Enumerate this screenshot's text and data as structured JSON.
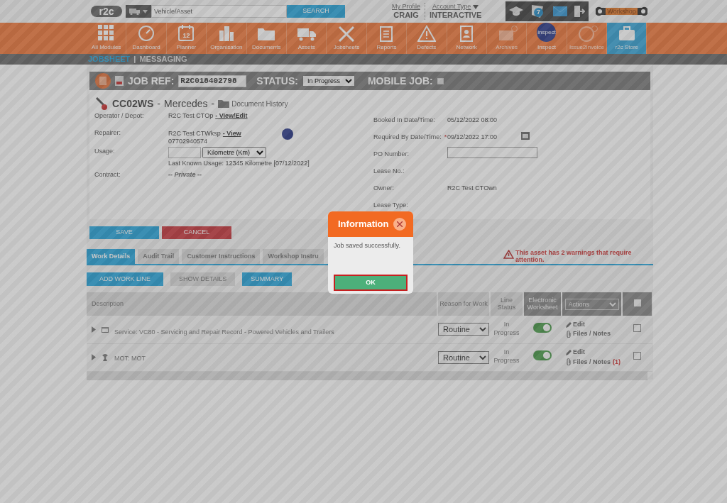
{
  "header": {
    "logo": "r2c",
    "search": {
      "placeholder": "Vehicle/Asset",
      "button": "SEARCH"
    },
    "profile": {
      "link": "My Profile",
      "name": "CRAIG"
    },
    "account": {
      "link": "Account Type",
      "value": "INTERACTIVE"
    },
    "notifications": "7",
    "workshop": "Workshop"
  },
  "modules": [
    {
      "label": "All Modules",
      "selected": false,
      "locked": false
    },
    {
      "label": "Dashboard",
      "selected": false,
      "locked": false
    },
    {
      "label": "Planner",
      "selected": false,
      "locked": false,
      "badge_text": "12"
    },
    {
      "label": "Organisation",
      "selected": false,
      "locked": false
    },
    {
      "label": "Documents",
      "selected": false,
      "locked": false
    },
    {
      "label": "Assets",
      "selected": false,
      "locked": false
    },
    {
      "label": "Jobsheets",
      "selected": false,
      "locked": false
    },
    {
      "label": "Reports",
      "selected": false,
      "locked": false
    },
    {
      "label": "Defects",
      "selected": false,
      "locked": false
    },
    {
      "label": "Network",
      "selected": false,
      "locked": false
    },
    {
      "label": "Archives",
      "selected": false,
      "locked": true
    },
    {
      "label": "Inspect",
      "selected": false,
      "locked": false,
      "badge_text": "inspect"
    },
    {
      "label": "Issue2Invoice",
      "selected": false,
      "locked": true
    },
    {
      "label": "r2c Store",
      "selected": true,
      "locked": false
    }
  ],
  "subnav_separator": "|",
  "subnav": [
    {
      "label": "JOBSHEET",
      "selected": true
    },
    {
      "label": "MESSAGING",
      "selected": false
    }
  ],
  "job_bar": {
    "ref_label": "JOB REF:",
    "ref": "R2C018402798",
    "status_label": "STATUS:",
    "status": "In Progress",
    "mobile_label": "MOBILE JOB:",
    "mobile_checked": false
  },
  "vehicle": {
    "reg": "CC02WS",
    "separator": "-",
    "make": "Mercedes",
    "separator_2": "-",
    "document_history": "Document History"
  },
  "left_fields": [
    {
      "kind": "text",
      "label": "Operator / Depot:",
      "value": "R2C Test CTOp",
      "link": "- View/Edit"
    },
    {
      "kind": "text",
      "label": "Repairer:",
      "value": "R2C Test CTWksp",
      "link": "- View",
      "sub": "07702940574",
      "badge": true
    },
    {
      "kind": "usage",
      "label": "Usage:",
      "unit": "Kilometre (Km)",
      "note": "Last Known Usage: 12345 Kilometre [07/12/2022]"
    },
    {
      "kind": "private",
      "label": "Contract:",
      "value": "-- Private --"
    }
  ],
  "right_fields": [
    {
      "kind": "text",
      "label": "Booked In Date/Time:",
      "value": "05/12/2022 08:00"
    },
    {
      "kind": "date",
      "label": "Required By Date/Time:",
      "required_mark": "*",
      "value": "09/12/2022 17:00"
    },
    {
      "kind": "input",
      "label": "PO Number:"
    },
    {
      "kind": "text",
      "label": "Lease No.:"
    },
    {
      "kind": "text",
      "label": "Owner:",
      "value": "R2C Test CTOwn"
    },
    {
      "kind": "text",
      "label": "Lease Type:"
    }
  ],
  "form_buttons": [
    {
      "label": "SAVE",
      "kind": "primary"
    },
    {
      "label": "CANCEL",
      "kind": "danger"
    }
  ],
  "tabs": [
    {
      "label": "Work Details",
      "selected": true
    },
    {
      "label": "Audit Trail",
      "selected": false
    },
    {
      "label": "Customer Instructions",
      "selected": false
    },
    {
      "label": "Workshop Instru",
      "selected": false
    }
  ],
  "warning": "This asset has 2 warnings that require attention.",
  "work_buttons": [
    {
      "label": "ADD WORK LINE",
      "kind": "primary"
    },
    {
      "label": "SHOW DETAILS",
      "kind": "plain"
    },
    {
      "label": "SUMMARY",
      "kind": "primary"
    }
  ],
  "table": {
    "columns": {
      "description": "Description",
      "reason": "Reason for Work",
      "status": "Line Status",
      "worksheet": "Electronic Worksheet",
      "actions": "Actions",
      "select_all_checked": false
    },
    "rows": [
      {
        "kind": "service",
        "description": "Service: VC80 - Servicing and Repair Record - Powered Vehicles and Trailers",
        "reason": "Routine",
        "status": "In Progress",
        "worksheet_on": true,
        "edit": "Edit",
        "files": "Files / Notes",
        "checked": false
      },
      {
        "kind": "mot",
        "description": "MOT: MOT",
        "reason": "Routine",
        "status": "In Progress",
        "worksheet_on": true,
        "edit": "Edit",
        "files": "Files / Notes",
        "files_count": "(1)",
        "checked": false
      }
    ]
  },
  "modal": {
    "title": "Information",
    "message": "Job saved successfully.",
    "ok": "OK",
    "ok_focused": true
  }
}
